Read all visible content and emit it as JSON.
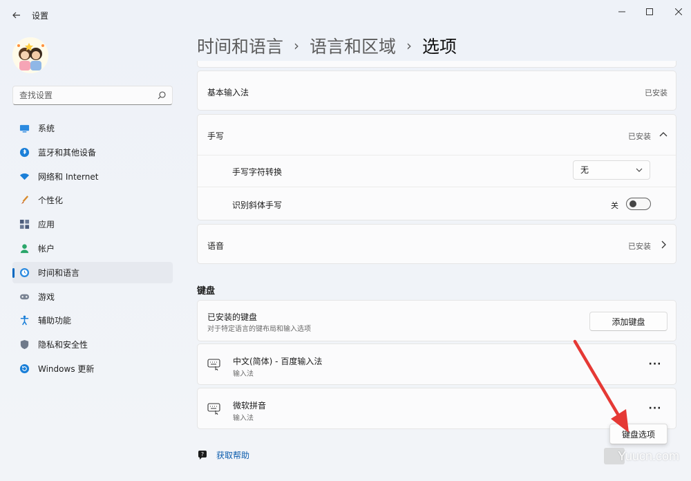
{
  "titlebar": {
    "app_title": "设置"
  },
  "search": {
    "placeholder": "查找设置"
  },
  "sidebar": {
    "items": [
      {
        "label": "系统",
        "icon": "system-icon"
      },
      {
        "label": "蓝牙和其他设备",
        "icon": "bluetooth-icon"
      },
      {
        "label": "网络和 Internet",
        "icon": "wifi-icon"
      },
      {
        "label": "个性化",
        "icon": "brush-icon"
      },
      {
        "label": "应用",
        "icon": "apps-icon"
      },
      {
        "label": "帐户",
        "icon": "account-icon"
      },
      {
        "label": "时间和语言",
        "icon": "clock-globe-icon",
        "active": true
      },
      {
        "label": "游戏",
        "icon": "gamepad-icon"
      },
      {
        "label": "辅助功能",
        "icon": "accessibility-icon"
      },
      {
        "label": "隐私和安全性",
        "icon": "shield-icon"
      },
      {
        "label": "Windows 更新",
        "icon": "update-icon"
      }
    ]
  },
  "breadcrumb": {
    "level1": "时间和语言",
    "level2": "语言和区域",
    "current": "选项",
    "separator": "›"
  },
  "basic_input": {
    "label": "基本输入法",
    "status": "已安装"
  },
  "handwriting": {
    "label": "手写",
    "status": "已安装",
    "char_conversion": {
      "label": "手写字符转换",
      "value": "无"
    },
    "italic": {
      "label": "识别斜体手写",
      "state": "关"
    }
  },
  "speech": {
    "label": "语音",
    "status": "已安装"
  },
  "keyboard_section": {
    "title": "键盘"
  },
  "installed_keyboards": {
    "label": "已安装的键盘",
    "desc": "对于特定语言的键布局和输入选项",
    "add_button": "添加键盘"
  },
  "keyboards": [
    {
      "name": "中文(简体) - 百度输入法",
      "type": "输入法",
      "more": "···"
    },
    {
      "name": "微软拼音",
      "type": "输入法",
      "more": "···"
    }
  ],
  "popup_options": {
    "label": "键盘选项"
  },
  "help": {
    "label": "获取帮助"
  },
  "watermark": {
    "text": "Yuucn.com"
  },
  "colors": {
    "accent": "#0067c0",
    "arrow": "#e53935",
    "link": "#0b5cad"
  }
}
